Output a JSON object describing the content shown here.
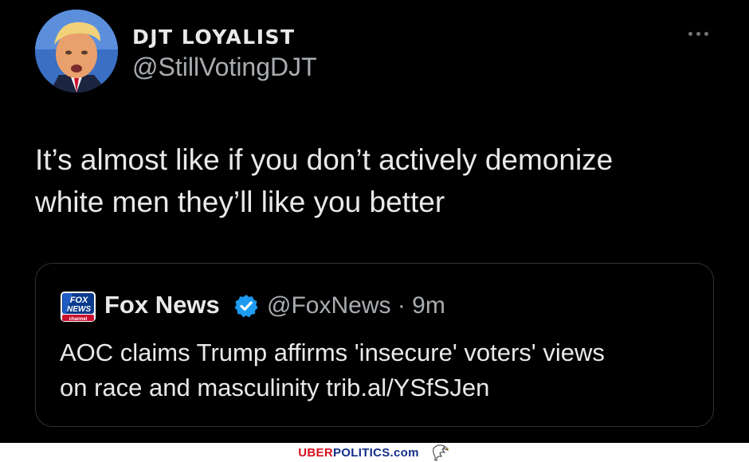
{
  "tweet": {
    "display_name": "DJT LOYALIST",
    "handle": "@StillVotingDJT",
    "text_line1": "It’s almost like if you don’t actively demonize",
    "text_line2": "white men they’ll like you better",
    "more_icon": "more-horizontal-icon"
  },
  "quote": {
    "name": "Fox News",
    "handle": "@FoxNews",
    "separator": "·",
    "time": "9m",
    "text_line1": "AOC claims Trump affirms 'insecure' voters' views",
    "text_line2": "on race and masculinity trib.al/YSfSJen",
    "logo_text_top": "FOX",
    "logo_text_mid": "NEWS",
    "logo_text_bottom": "channel",
    "verified_icon": "verified-badge-icon",
    "verified_color": "#1d9bf0"
  },
  "watermark": {
    "part1": "UBER",
    "part2": "POLITICS",
    "part3": ".com",
    "red": "#d8101d",
    "blue": "#132f87"
  }
}
